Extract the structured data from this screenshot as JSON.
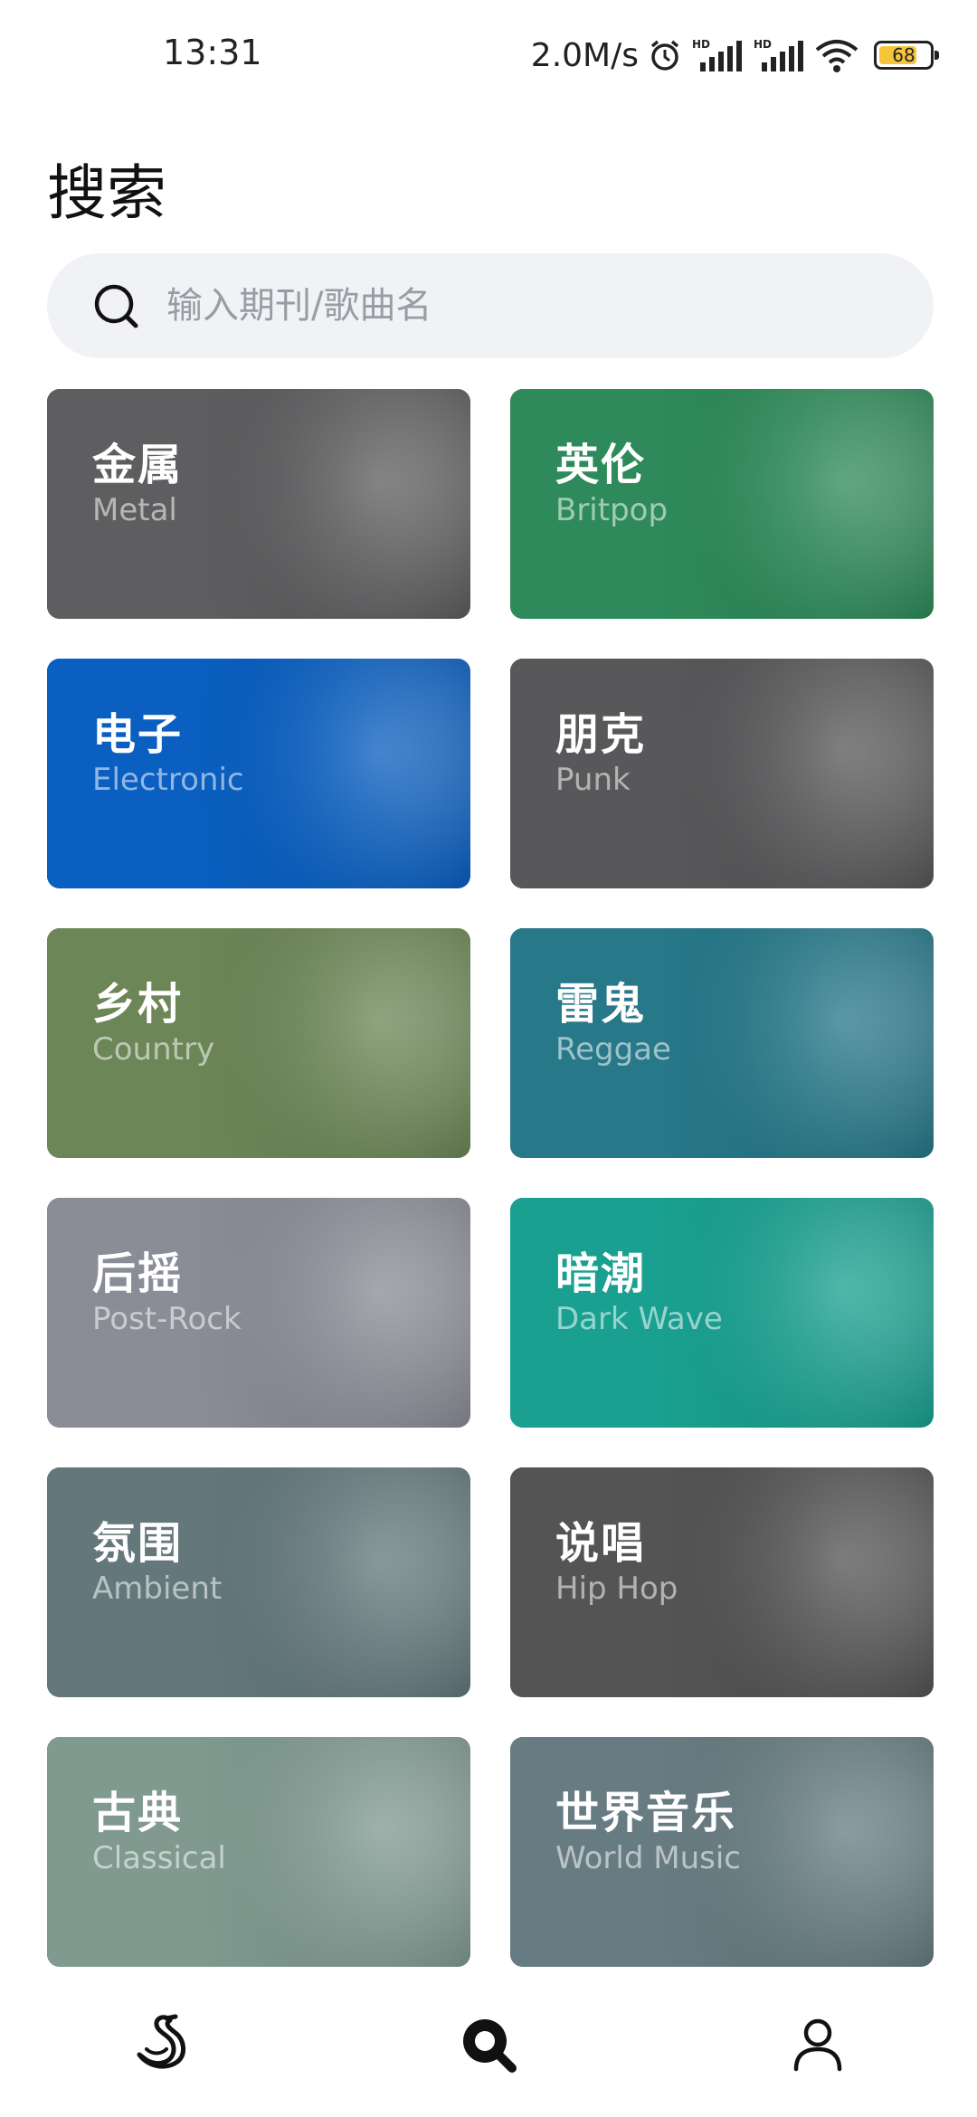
{
  "status_bar": {
    "time": "13:31",
    "net_speed": "2.0M/s",
    "battery_level": "68",
    "icons": [
      "alarm-icon",
      "hd-signal-icon",
      "hd-signal-icon",
      "wifi-icon",
      "battery-icon"
    ]
  },
  "page": {
    "title": "搜索"
  },
  "search": {
    "placeholder": "输入期刊/歌曲名",
    "value": ""
  },
  "genres": [
    {
      "zh": "金属",
      "en": "Metal",
      "color": "#5e5e60"
    },
    {
      "zh": "英伦",
      "en": "Britpop",
      "color": "#2e8a5a"
    },
    {
      "zh": "电子",
      "en": "Electronic",
      "color": "#0a5fc0"
    },
    {
      "zh": "朋克",
      "en": "Punk",
      "color": "#58585a"
    },
    {
      "zh": "乡村",
      "en": "Country",
      "color": "#6d8657"
    },
    {
      "zh": "雷鬼",
      "en": "Reggae",
      "color": "#277889"
    },
    {
      "zh": "后摇",
      "en": "Post-Rock",
      "color": "#8a8c96"
    },
    {
      "zh": "暗潮",
      "en": "Dark Wave",
      "color": "#1aa090"
    },
    {
      "zh": "氛围",
      "en": "Ambient",
      "color": "#64787c"
    },
    {
      "zh": "说唱",
      "en": "Hip Hop",
      "color": "#545454"
    },
    {
      "zh": "古典",
      "en": "Classical",
      "color": "#809a90"
    },
    {
      "zh": "世界音乐",
      "en": "World Music",
      "color": "#677c82"
    }
  ],
  "bottom_nav": {
    "items": [
      {
        "icon": "swan-logo-icon",
        "active": false
      },
      {
        "icon": "search-icon",
        "active": true
      },
      {
        "icon": "profile-icon",
        "active": false
      }
    ]
  }
}
